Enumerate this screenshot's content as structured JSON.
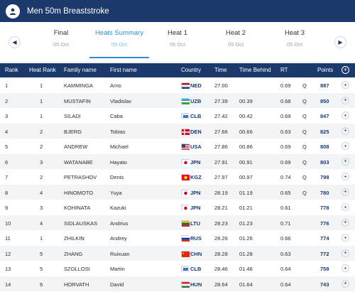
{
  "header": {
    "title": "Men 50m Breaststroke"
  },
  "tabs": [
    {
      "label": "Final",
      "date": "05 Oct",
      "active": false
    },
    {
      "label": "Heats Summary",
      "date": "05 Oct",
      "active": true
    },
    {
      "label": "Heat 1",
      "date": "05 Oct",
      "active": false
    },
    {
      "label": "Heat 2",
      "date": "05 Oct",
      "active": false
    },
    {
      "label": "Heat 3",
      "date": "05 Oct",
      "active": false
    }
  ],
  "columns": {
    "rank": "Rank",
    "heat_rank": "Heat Rank",
    "family_name": "Family name",
    "first_name": "First name",
    "country": "Country",
    "time": "Time",
    "time_behind": "Time Behind",
    "rt": "RT",
    "points": "Points"
  },
  "rows": [
    {
      "rank": "1",
      "heat_rank": "1",
      "family": "KAMMINGA",
      "first": "Arno",
      "country": "NED",
      "flag": "ned",
      "time": "27.00",
      "behind": "",
      "rt": "0.69",
      "q": "Q",
      "points": "887"
    },
    {
      "rank": "2",
      "heat_rank": "1",
      "family": "MUSTAFIN",
      "first": "Vladislav",
      "country": "UZB",
      "flag": "uzb",
      "time": "27.39",
      "behind": "00.39",
      "rt": "0.68",
      "q": "Q",
      "points": "850"
    },
    {
      "rank": "3",
      "heat_rank": "1",
      "family": "SILADI",
      "first": "Caba",
      "country": "CLB",
      "flag": "clb",
      "time": "27.42",
      "behind": "00.42",
      "rt": "0.69",
      "q": "Q",
      "points": "847"
    },
    {
      "rank": "4",
      "heat_rank": "2",
      "family": "BJERG",
      "first": "Tobias",
      "country": "DEN",
      "flag": "den",
      "time": "27.66",
      "behind": "00.66",
      "rt": "0.63",
      "q": "Q",
      "points": "825"
    },
    {
      "rank": "5",
      "heat_rank": "2",
      "family": "ANDREW",
      "first": "Michael",
      "country": "USA",
      "flag": "usa",
      "time": "27.86",
      "behind": "00.86",
      "rt": "0.69",
      "q": "Q",
      "points": "808"
    },
    {
      "rank": "6",
      "heat_rank": "3",
      "family": "WATANABE",
      "first": "Hayato",
      "country": "JPN",
      "flag": "jpn",
      "time": "27.91",
      "behind": "00.91",
      "rt": "0.69",
      "q": "Q",
      "points": "803"
    },
    {
      "rank": "7",
      "heat_rank": "2",
      "family": "PETRASHOV",
      "first": "Denis",
      "country": "KGZ",
      "flag": "kgz",
      "time": "27.97",
      "behind": "00.97",
      "rt": "0.74",
      "q": "Q",
      "points": "798"
    },
    {
      "rank": "8",
      "heat_rank": "4",
      "family": "HINOMOTO",
      "first": "Yuya",
      "country": "JPN",
      "flag": "jpn",
      "time": "28.19",
      "behind": "01.19",
      "rt": "0.65",
      "q": "Q",
      "points": "780"
    },
    {
      "rank": "9",
      "heat_rank": "3",
      "family": "KOHINATA",
      "first": "Kazuki",
      "country": "JPN",
      "flag": "jpn",
      "time": "28.21",
      "behind": "01.21",
      "rt": "0.61",
      "q": "",
      "points": "778"
    },
    {
      "rank": "10",
      "heat_rank": "4",
      "family": "SIDLAUSKAS",
      "first": "Andrius",
      "country": "LTU",
      "flag": "ltu",
      "time": "28.23",
      "behind": "01.23",
      "rt": "0.71",
      "q": "",
      "points": "776"
    },
    {
      "rank": "11",
      "heat_rank": "1",
      "family": "ZHILKIN",
      "first": "Andrey",
      "country": "RUS",
      "flag": "rus",
      "time": "28.26",
      "behind": "01.26",
      "rt": "0.66",
      "q": "",
      "points": "774"
    },
    {
      "rank": "12",
      "heat_rank": "5",
      "family": "ZHANG",
      "first": "Ruixuan",
      "country": "CHN",
      "flag": "chn",
      "time": "28.28",
      "behind": "01.28",
      "rt": "0.63",
      "q": "",
      "points": "772"
    },
    {
      "rank": "13",
      "heat_rank": "5",
      "family": "SZOLLOSI",
      "first": "Martin",
      "country": "CLB",
      "flag": "clb",
      "time": "28.46",
      "behind": "01.46",
      "rt": "0.64",
      "q": "",
      "points": "758"
    },
    {
      "rank": "14",
      "heat_rank": "6",
      "family": "HORVATH",
      "first": "David",
      "country": "HUN",
      "flag": "hun",
      "time": "28.64",
      "behind": "01.64",
      "rt": "0.64",
      "q": "",
      "points": "743"
    }
  ]
}
